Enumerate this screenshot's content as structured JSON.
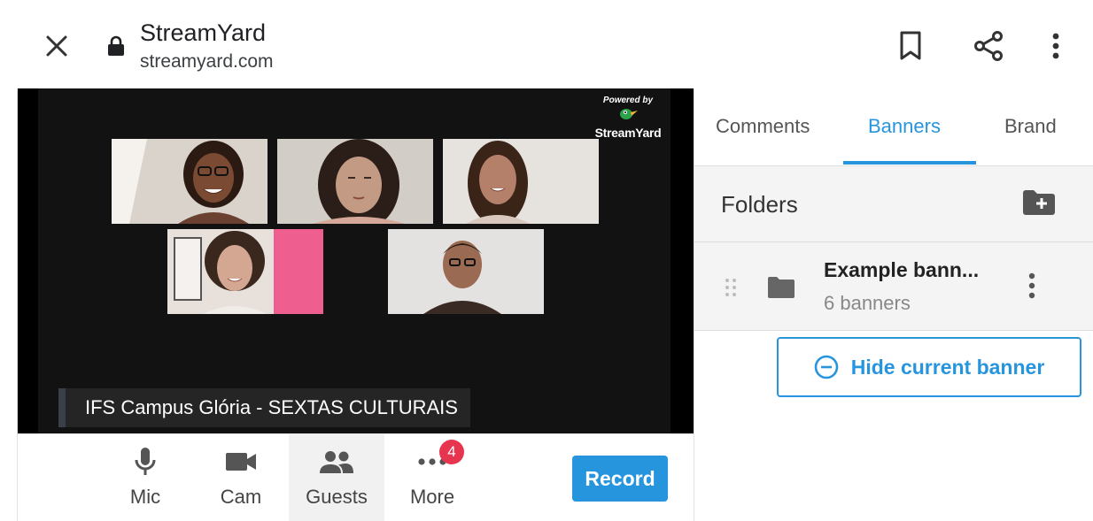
{
  "browser": {
    "title": "StreamYard",
    "url": "streamyard.com",
    "icons": [
      "close-icon",
      "lock-icon",
      "bookmark-icon",
      "share-icon",
      "more-vertical-icon"
    ]
  },
  "stage": {
    "powered_by": "Powered by",
    "brand": "StreamYard",
    "banner_text": "IFS Campus Glória - SEXTAS CULTURAIS"
  },
  "toolbar": {
    "mic_label": "Mic",
    "cam_label": "Cam",
    "guests_label": "Guests",
    "more_label": "More",
    "more_badge": "4",
    "record_label": "Record"
  },
  "panel": {
    "tabs": [
      {
        "label": "Comments"
      },
      {
        "label": "Banners"
      },
      {
        "label": "Brand"
      }
    ],
    "active_tab": "Banners",
    "folders_label": "Folders",
    "folder": {
      "name": "Example bann...",
      "count": "6 banners"
    },
    "hide_banner_label": "Hide current banner"
  },
  "colors": {
    "accent": "#2795dd",
    "badge": "#e8354f",
    "stage_bg": "#121212"
  }
}
